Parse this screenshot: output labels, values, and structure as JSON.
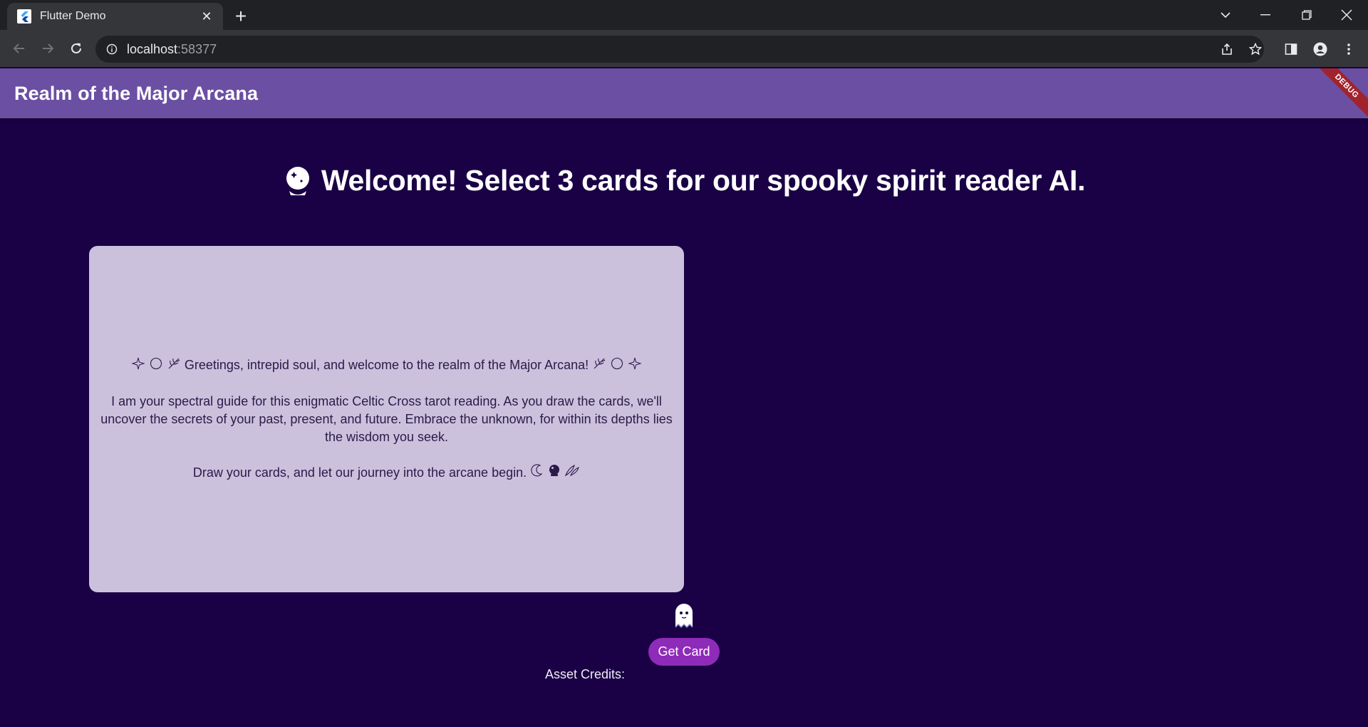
{
  "browser": {
    "tab_title": "Flutter Demo",
    "url_host": "localhost",
    "url_port": ":58377"
  },
  "app": {
    "title": "Realm of the Major Arcana",
    "debug_banner": "DEBUG",
    "welcome": "Welcome! Select 3 cards for our spooky spirit reader AI.",
    "reader": {
      "greeting": "Greetings, intrepid soul, and welcome to the realm of the Major Arcana!",
      "body": "I am your spectral guide for this enigmatic Celtic Cross tarot reading. As you draw the cards, we'll uncover the secrets of your past, present, and future. Embrace the unknown, for within its depths lies the wisdom you seek.",
      "closing": "Draw your cards, and let our journey into the arcane begin."
    },
    "get_card_label": "Get Card",
    "asset_credits": "Asset Credits:"
  },
  "icons": {
    "crystal_ball": "crystal-ball-icon",
    "ghost": "ghost-icon"
  },
  "colors": {
    "background": "#1a0045",
    "appbar": "#6b4fa3",
    "card": "#cbc1dc",
    "button": "#8e2bb8",
    "debug": "#a1232e"
  }
}
